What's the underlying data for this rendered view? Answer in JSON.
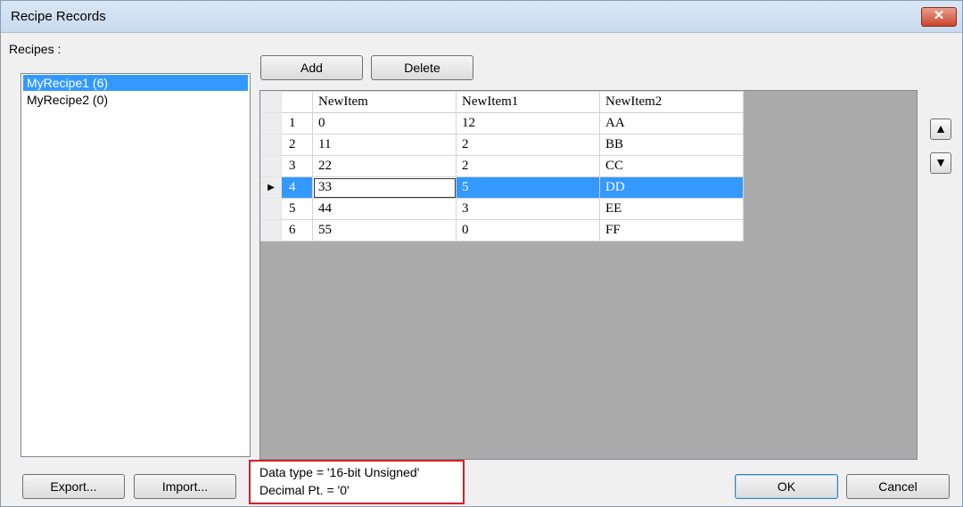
{
  "window": {
    "title": "Recipe Records",
    "close_label": "✕"
  },
  "recipes": {
    "label": "Recipes :",
    "items": [
      {
        "label": "MyRecipe1 (6)"
      },
      {
        "label": "MyRecipe2 (0)"
      }
    ]
  },
  "toolbar": {
    "add_label": "Add",
    "delete_label": "Delete"
  },
  "table": {
    "columns": [
      "",
      "NewItem",
      "NewItem1",
      "NewItem2"
    ],
    "rows": [
      {
        "num": "1",
        "cells": [
          "0",
          "12",
          "AA"
        ]
      },
      {
        "num": "2",
        "cells": [
          "11",
          "2",
          "BB"
        ]
      },
      {
        "num": "3",
        "cells": [
          "22",
          "2",
          "CC"
        ]
      },
      {
        "num": "4",
        "cells": [
          "33",
          "5",
          "DD"
        ]
      },
      {
        "num": "5",
        "cells": [
          "44",
          "3",
          "EE"
        ]
      },
      {
        "num": "6",
        "cells": [
          "55",
          "0",
          "FF"
        ]
      }
    ],
    "current_row_marker": "▶"
  },
  "side_buttons": {
    "up": "▲",
    "down": "▼"
  },
  "footer": {
    "export_label": "Export...",
    "import_label": "Import...",
    "data_type_text": "Data type = '16-bit Unsigned'",
    "decimal_text": "Decimal Pt. = '0'",
    "ok_label": "OK",
    "cancel_label": "Cancel"
  }
}
